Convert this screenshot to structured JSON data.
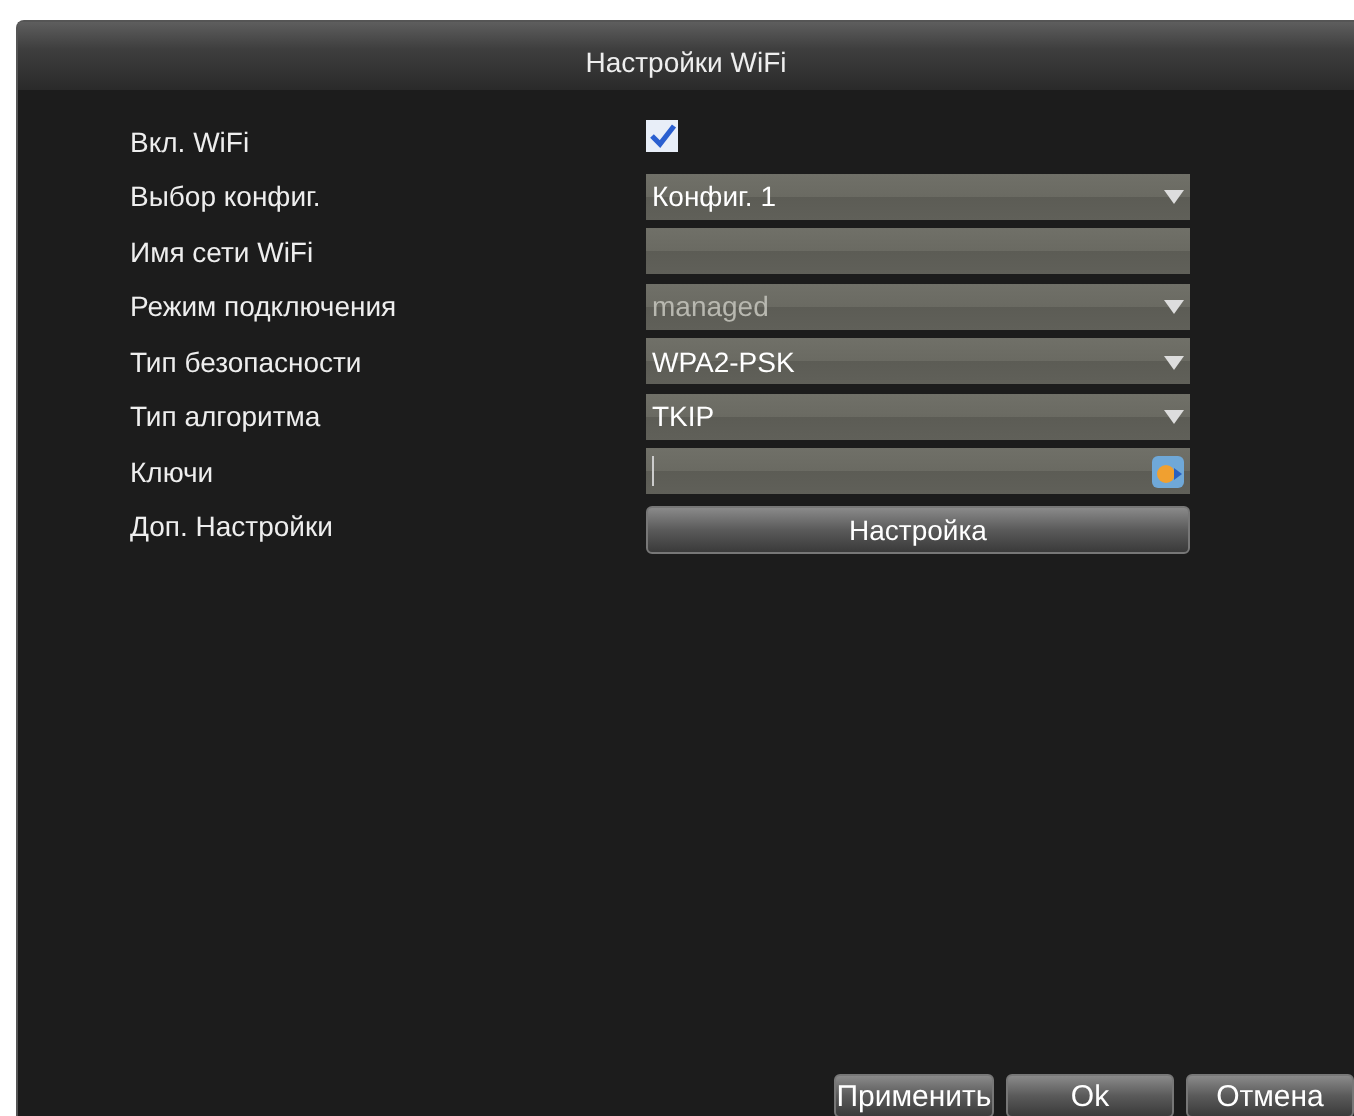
{
  "window": {
    "title": "Настройки WiFi"
  },
  "rows": [
    {
      "kind": "checkbox",
      "label": "Вкл. WiFi",
      "checked": true
    },
    {
      "kind": "select",
      "label": "Выбор конфиг.",
      "value": "Конфиг. 1",
      "disabled": false
    },
    {
      "kind": "text",
      "label": "Имя сети WiFi"
    },
    {
      "kind": "select",
      "label": "Режим подключения",
      "value": "managed",
      "disabled": true
    },
    {
      "kind": "select",
      "label": "Тип безопасности",
      "value": "WPA2-PSK",
      "disabled": false
    },
    {
      "kind": "select",
      "label": "Тип алгоритма",
      "value": "TKIP",
      "disabled": false
    },
    {
      "kind": "key",
      "label": "Ключи"
    },
    {
      "kind": "button",
      "label": "Доп. Настройки",
      "value": "Настройка"
    }
  ],
  "buttons": [
    "Применить",
    "Ok",
    "Отмена"
  ]
}
